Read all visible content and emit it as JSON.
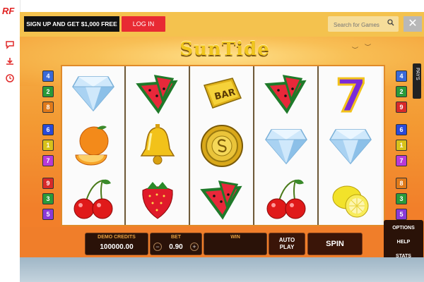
{
  "brand": {
    "logo": "RF"
  },
  "sidebar": {
    "icons": [
      "chat-icon",
      "download-icon",
      "history-icon"
    ]
  },
  "header": {
    "signup_label": "SIGN UP AND GET $1,000 FREE",
    "login_label": "LOG IN",
    "search": {
      "placeholder": "Search for Games"
    },
    "close_label": "✕"
  },
  "game": {
    "title": "SunTide",
    "paytable_tab": "PAYS",
    "left_paylines": [
      "4",
      "2",
      "8",
      "6",
      "1",
      "7",
      "9",
      "3",
      "5"
    ],
    "right_paylines": [
      "4",
      "2",
      "9",
      "6",
      "1",
      "7",
      "8",
      "3",
      "5"
    ],
    "reels": [
      [
        "diamond",
        "orange",
        "cherries"
      ],
      [
        "watermelon",
        "bell",
        "strawberry"
      ],
      [
        "bar",
        "sun-coin",
        "watermelon"
      ],
      [
        "watermelon",
        "diamond",
        "cherries"
      ],
      [
        "seven",
        "diamond",
        "lemon"
      ]
    ],
    "bar_label": "BAR",
    "seven_label": "7",
    "demo_credits_label": "DEMO CREDITS",
    "demo_credits_value": "100000.00",
    "bet_label": "BET",
    "bet_value": "0.90",
    "bet_minus": "−",
    "bet_plus": "+",
    "win_label": "WIN",
    "win_value": "",
    "autoplay_label_1": "AUTO",
    "autoplay_label_2": "PLAY",
    "spin_label": "SPIN",
    "menu": [
      "OPTIONS",
      "HELP",
      "STATS"
    ]
  },
  "colors": {
    "accent_red": "#e82a33",
    "topbar": "#f4c24e",
    "payline_colors": {
      "1": "#d8c21a",
      "2": "#2a9a3a",
      "3": "#2a9a3a",
      "4": "#3a6ad8",
      "5": "#8a3ad8",
      "6": "#2a4ad8",
      "7": "#b83ad8",
      "8": "#e07a1a",
      "9": "#d82a2a"
    }
  }
}
